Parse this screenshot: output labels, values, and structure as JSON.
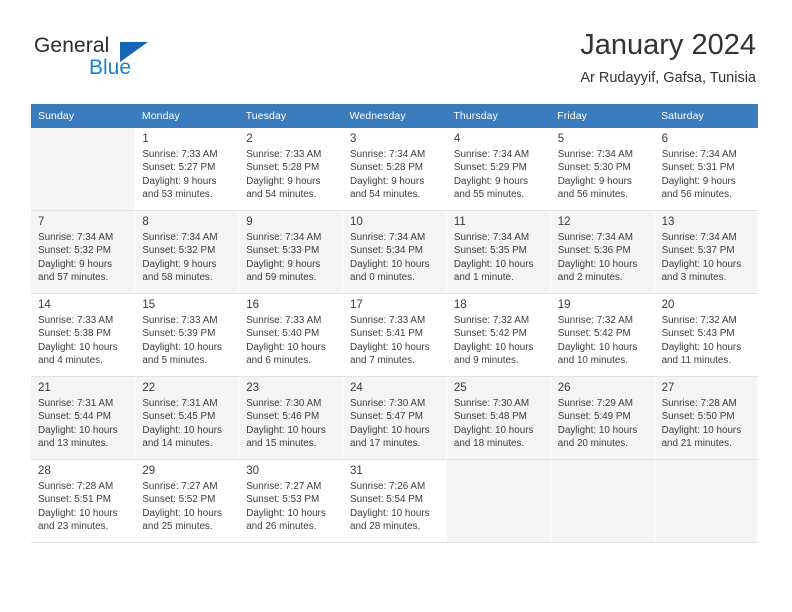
{
  "brand": {
    "name_part1": "General",
    "name_part2": "Blue",
    "triangle_color": "#1565b5",
    "blue_color": "#1a7fd4"
  },
  "header": {
    "title": "January 2024",
    "subtitle": "Ar Rudayyif, Gafsa, Tunisia",
    "header_bg": "#3b7cbf"
  },
  "calendar": {
    "weekday_headers": [
      "Sunday",
      "Monday",
      "Tuesday",
      "Wednesday",
      "Thursday",
      "Friday",
      "Saturday"
    ],
    "weeks": [
      [
        {
          "day": "",
          "sunrise": "",
          "sunset": "",
          "daylight_line1": "",
          "daylight_line2": ""
        },
        {
          "day": "1",
          "sunrise": "Sunrise: 7:33 AM",
          "sunset": "Sunset: 5:27 PM",
          "daylight_line1": "Daylight: 9 hours",
          "daylight_line2": "and 53 minutes."
        },
        {
          "day": "2",
          "sunrise": "Sunrise: 7:33 AM",
          "sunset": "Sunset: 5:28 PM",
          "daylight_line1": "Daylight: 9 hours",
          "daylight_line2": "and 54 minutes."
        },
        {
          "day": "3",
          "sunrise": "Sunrise: 7:34 AM",
          "sunset": "Sunset: 5:28 PM",
          "daylight_line1": "Daylight: 9 hours",
          "daylight_line2": "and 54 minutes."
        },
        {
          "day": "4",
          "sunrise": "Sunrise: 7:34 AM",
          "sunset": "Sunset: 5:29 PM",
          "daylight_line1": "Daylight: 9 hours",
          "daylight_line2": "and 55 minutes."
        },
        {
          "day": "5",
          "sunrise": "Sunrise: 7:34 AM",
          "sunset": "Sunset: 5:30 PM",
          "daylight_line1": "Daylight: 9 hours",
          "daylight_line2": "and 56 minutes."
        },
        {
          "day": "6",
          "sunrise": "Sunrise: 7:34 AM",
          "sunset": "Sunset: 5:31 PM",
          "daylight_line1": "Daylight: 9 hours",
          "daylight_line2": "and 56 minutes."
        }
      ],
      [
        {
          "day": "7",
          "sunrise": "Sunrise: 7:34 AM",
          "sunset": "Sunset: 5:32 PM",
          "daylight_line1": "Daylight: 9 hours",
          "daylight_line2": "and 57 minutes."
        },
        {
          "day": "8",
          "sunrise": "Sunrise: 7:34 AM",
          "sunset": "Sunset: 5:32 PM",
          "daylight_line1": "Daylight: 9 hours",
          "daylight_line2": "and 58 minutes."
        },
        {
          "day": "9",
          "sunrise": "Sunrise: 7:34 AM",
          "sunset": "Sunset: 5:33 PM",
          "daylight_line1": "Daylight: 9 hours",
          "daylight_line2": "and 59 minutes."
        },
        {
          "day": "10",
          "sunrise": "Sunrise: 7:34 AM",
          "sunset": "Sunset: 5:34 PM",
          "daylight_line1": "Daylight: 10 hours",
          "daylight_line2": "and 0 minutes."
        },
        {
          "day": "11",
          "sunrise": "Sunrise: 7:34 AM",
          "sunset": "Sunset: 5:35 PM",
          "daylight_line1": "Daylight: 10 hours",
          "daylight_line2": "and 1 minute."
        },
        {
          "day": "12",
          "sunrise": "Sunrise: 7:34 AM",
          "sunset": "Sunset: 5:36 PM",
          "daylight_line1": "Daylight: 10 hours",
          "daylight_line2": "and 2 minutes."
        },
        {
          "day": "13",
          "sunrise": "Sunrise: 7:34 AM",
          "sunset": "Sunset: 5:37 PM",
          "daylight_line1": "Daylight: 10 hours",
          "daylight_line2": "and 3 minutes."
        }
      ],
      [
        {
          "day": "14",
          "sunrise": "Sunrise: 7:33 AM",
          "sunset": "Sunset: 5:38 PM",
          "daylight_line1": "Daylight: 10 hours",
          "daylight_line2": "and 4 minutes."
        },
        {
          "day": "15",
          "sunrise": "Sunrise: 7:33 AM",
          "sunset": "Sunset: 5:39 PM",
          "daylight_line1": "Daylight: 10 hours",
          "daylight_line2": "and 5 minutes."
        },
        {
          "day": "16",
          "sunrise": "Sunrise: 7:33 AM",
          "sunset": "Sunset: 5:40 PM",
          "daylight_line1": "Daylight: 10 hours",
          "daylight_line2": "and 6 minutes."
        },
        {
          "day": "17",
          "sunrise": "Sunrise: 7:33 AM",
          "sunset": "Sunset: 5:41 PM",
          "daylight_line1": "Daylight: 10 hours",
          "daylight_line2": "and 7 minutes."
        },
        {
          "day": "18",
          "sunrise": "Sunrise: 7:32 AM",
          "sunset": "Sunset: 5:42 PM",
          "daylight_line1": "Daylight: 10 hours",
          "daylight_line2": "and 9 minutes."
        },
        {
          "day": "19",
          "sunrise": "Sunrise: 7:32 AM",
          "sunset": "Sunset: 5:42 PM",
          "daylight_line1": "Daylight: 10 hours",
          "daylight_line2": "and 10 minutes."
        },
        {
          "day": "20",
          "sunrise": "Sunrise: 7:32 AM",
          "sunset": "Sunset: 5:43 PM",
          "daylight_line1": "Daylight: 10 hours",
          "daylight_line2": "and 11 minutes."
        }
      ],
      [
        {
          "day": "21",
          "sunrise": "Sunrise: 7:31 AM",
          "sunset": "Sunset: 5:44 PM",
          "daylight_line1": "Daylight: 10 hours",
          "daylight_line2": "and 13 minutes."
        },
        {
          "day": "22",
          "sunrise": "Sunrise: 7:31 AM",
          "sunset": "Sunset: 5:45 PM",
          "daylight_line1": "Daylight: 10 hours",
          "daylight_line2": "and 14 minutes."
        },
        {
          "day": "23",
          "sunrise": "Sunrise: 7:30 AM",
          "sunset": "Sunset: 5:46 PM",
          "daylight_line1": "Daylight: 10 hours",
          "daylight_line2": "and 15 minutes."
        },
        {
          "day": "24",
          "sunrise": "Sunrise: 7:30 AM",
          "sunset": "Sunset: 5:47 PM",
          "daylight_line1": "Daylight: 10 hours",
          "daylight_line2": "and 17 minutes."
        },
        {
          "day": "25",
          "sunrise": "Sunrise: 7:30 AM",
          "sunset": "Sunset: 5:48 PM",
          "daylight_line1": "Daylight: 10 hours",
          "daylight_line2": "and 18 minutes."
        },
        {
          "day": "26",
          "sunrise": "Sunrise: 7:29 AM",
          "sunset": "Sunset: 5:49 PM",
          "daylight_line1": "Daylight: 10 hours",
          "daylight_line2": "and 20 minutes."
        },
        {
          "day": "27",
          "sunrise": "Sunrise: 7:28 AM",
          "sunset": "Sunset: 5:50 PM",
          "daylight_line1": "Daylight: 10 hours",
          "daylight_line2": "and 21 minutes."
        }
      ],
      [
        {
          "day": "28",
          "sunrise": "Sunrise: 7:28 AM",
          "sunset": "Sunset: 5:51 PM",
          "daylight_line1": "Daylight: 10 hours",
          "daylight_line2": "and 23 minutes."
        },
        {
          "day": "29",
          "sunrise": "Sunrise: 7:27 AM",
          "sunset": "Sunset: 5:52 PM",
          "daylight_line1": "Daylight: 10 hours",
          "daylight_line2": "and 25 minutes."
        },
        {
          "day": "30",
          "sunrise": "Sunrise: 7:27 AM",
          "sunset": "Sunset: 5:53 PM",
          "daylight_line1": "Daylight: 10 hours",
          "daylight_line2": "and 26 minutes."
        },
        {
          "day": "31",
          "sunrise": "Sunrise: 7:26 AM",
          "sunset": "Sunset: 5:54 PM",
          "daylight_line1": "Daylight: 10 hours",
          "daylight_line2": "and 28 minutes."
        },
        {
          "day": "",
          "sunrise": "",
          "sunset": "",
          "daylight_line1": "",
          "daylight_line2": ""
        },
        {
          "day": "",
          "sunrise": "",
          "sunset": "",
          "daylight_line1": "",
          "daylight_line2": ""
        },
        {
          "day": "",
          "sunrise": "",
          "sunset": "",
          "daylight_line1": "",
          "daylight_line2": ""
        }
      ]
    ]
  }
}
